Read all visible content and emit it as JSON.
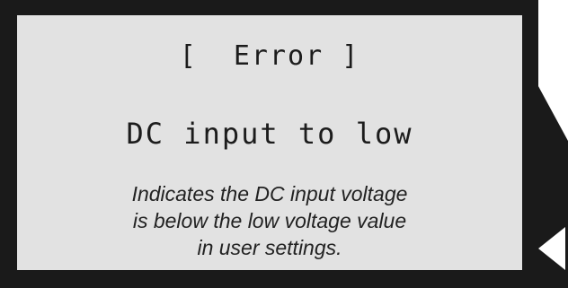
{
  "screen": {
    "title": "[  Error ]",
    "message": "DC input to low"
  },
  "description": {
    "lines": [
      "Indicates the DC input voltage",
      "is below the low voltage value",
      "in user settings."
    ]
  },
  "icons": {
    "nav_arrow": "left-triangle-icon"
  },
  "colors": {
    "frame": "#1a1a1a",
    "lcd_background": "#e2e2e2",
    "text": "#1c1c1c"
  }
}
